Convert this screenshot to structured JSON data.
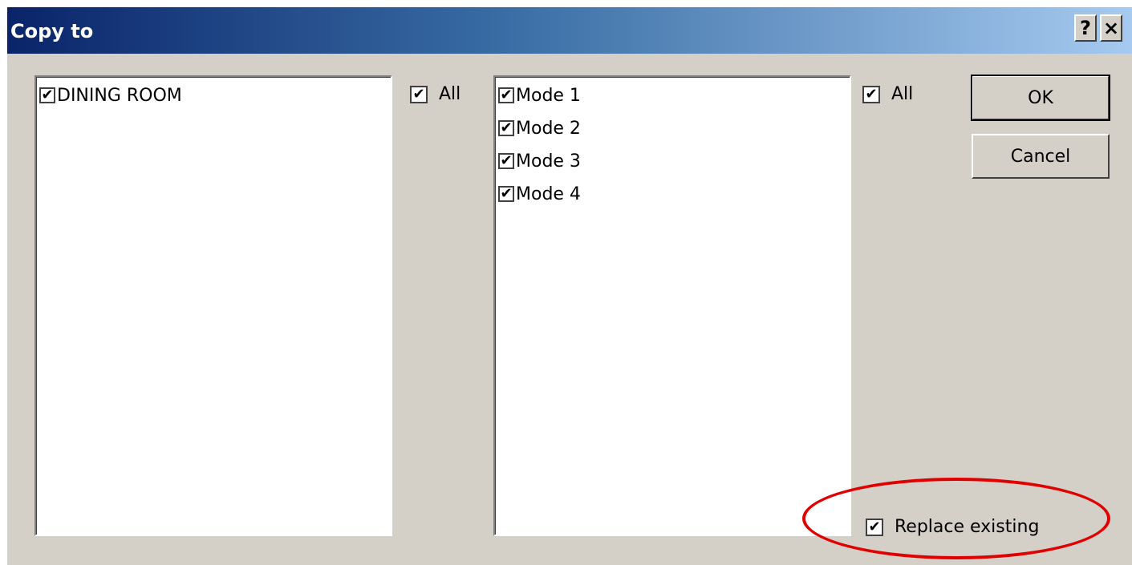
{
  "window": {
    "title": "Copy to",
    "help_label": "?",
    "close_label": "×"
  },
  "rooms": {
    "all_label": "All",
    "all_checked": true,
    "items": [
      {
        "label": "DINING ROOM",
        "checked": true
      }
    ]
  },
  "modes": {
    "all_label": "All",
    "all_checked": true,
    "items": [
      {
        "label": "Mode 1",
        "checked": true
      },
      {
        "label": "Mode 2",
        "checked": true
      },
      {
        "label": "Mode 3",
        "checked": true
      },
      {
        "label": "Mode 4",
        "checked": true
      }
    ]
  },
  "options": {
    "replace_label": "Replace existing",
    "replace_checked": true
  },
  "buttons": {
    "ok_label": "OK",
    "cancel_label": "Cancel"
  },
  "colors": {
    "titlebar_start": "#0a246a",
    "titlebar_end": "#a6caf0",
    "dialog_face": "#d4d0c8",
    "annotation": "#e00000"
  },
  "icons": {
    "check": "checkmark-icon",
    "help": "help-icon",
    "close": "close-icon"
  }
}
